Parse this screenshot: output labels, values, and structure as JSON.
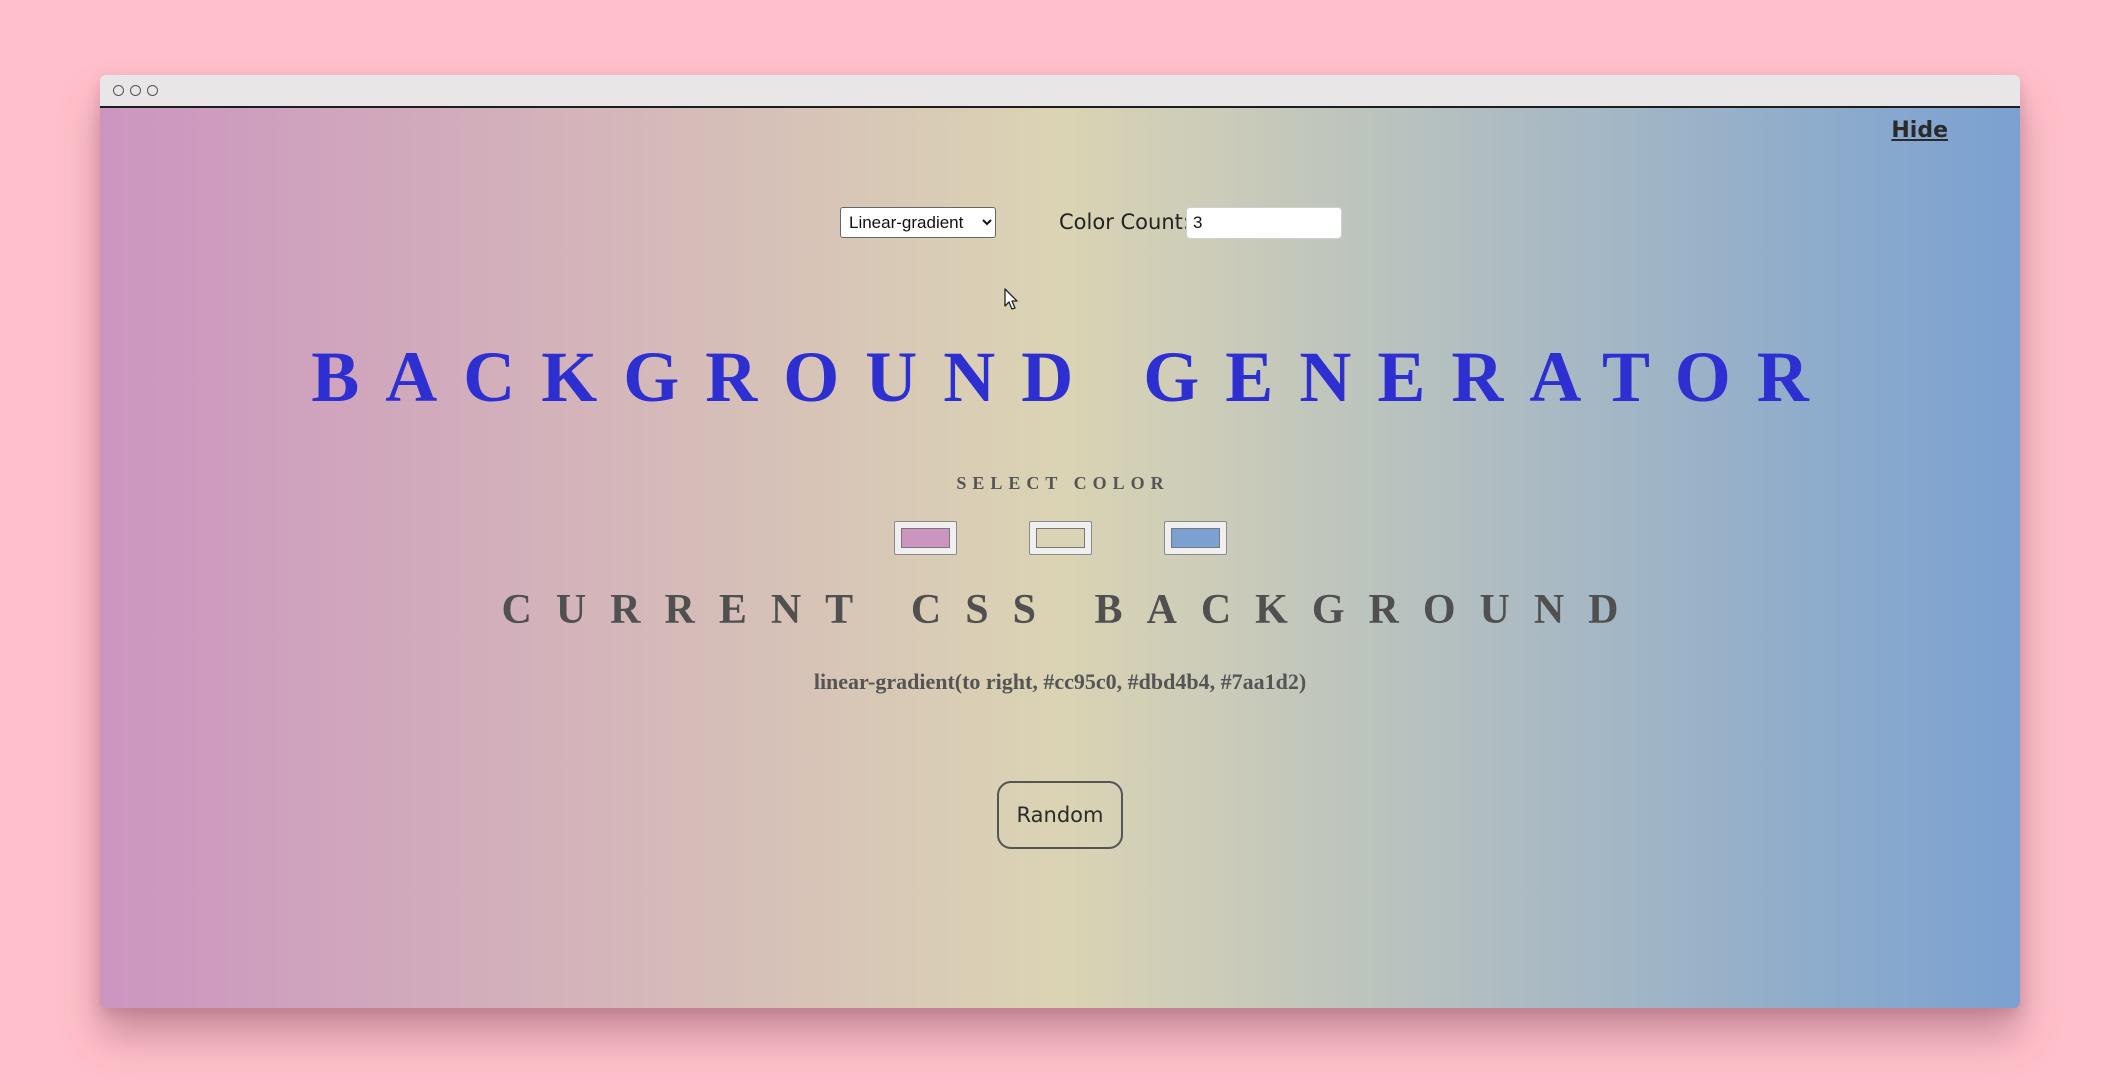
{
  "window": {
    "controls": [
      "close",
      "minimize",
      "maximize"
    ]
  },
  "hide_link": "Hide",
  "controls": {
    "gradient_type": "Linear-gradient",
    "gradient_options": [
      "Linear-gradient"
    ],
    "color_count_label": "Color Count:",
    "color_count_value": "3"
  },
  "title": "BACKGROUND GENERATOR",
  "select_color_label": "SELECT COLOR",
  "colors": [
    {
      "name": "color-1",
      "value": "#cc95c0"
    },
    {
      "name": "color-2",
      "value": "#dbd4b4"
    },
    {
      "name": "color-3",
      "value": "#7aa1d2"
    }
  ],
  "current_heading": "CURRENT CSS BACKGROUND",
  "css_output": "linear-gradient(to right, #cc95c0, #dbd4b4, #7aa1d2)",
  "random_button": "Random",
  "icons": {
    "cursor": "mouse-pointer-icon"
  },
  "theme": {
    "page_bg": "#ffc0cb",
    "title_color": "#2e2fd0",
    "text_color": "#505050"
  }
}
